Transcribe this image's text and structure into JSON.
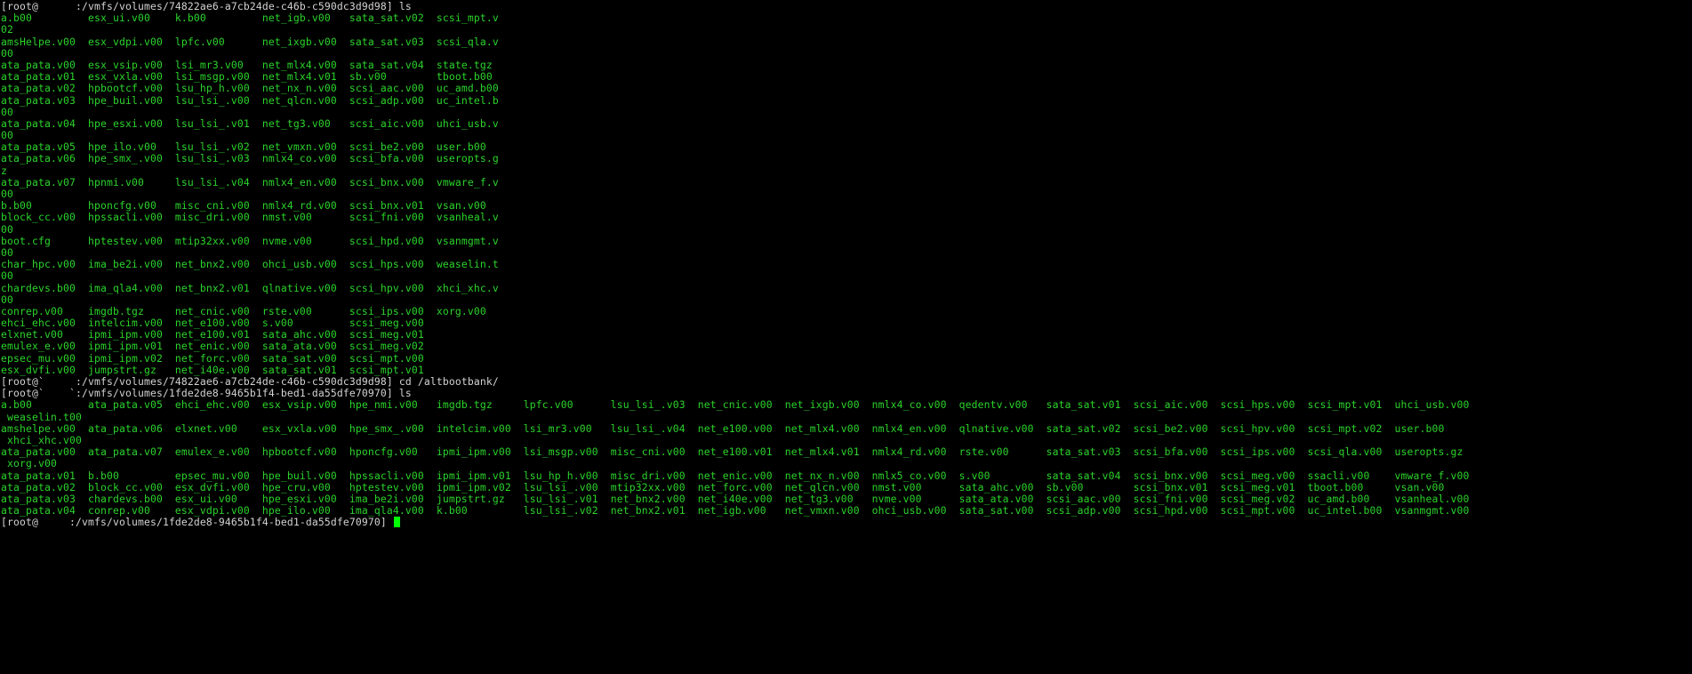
{
  "terminal": {
    "lines": [
      {
        "kind": "prompt",
        "text": "[root@      :/vmfs/volumes/74822ae6-a7cb24de-c46b-c590dc3d9d98] ls"
      },
      {
        "kind": "ls",
        "text": "a.b00         esx_ui.v00    k.b00         net_igb.v00   sata_sat.v02  scsi_mpt.v"
      },
      {
        "kind": "ls",
        "text": "02"
      },
      {
        "kind": "ls",
        "text": "amsHelpe.v00  esx_vdpi.v00  lpfc.v00      net_ixgb.v00  sata_sat.v03  scsi_qla.v"
      },
      {
        "kind": "ls",
        "text": "00"
      },
      {
        "kind": "ls",
        "text": "ata_pata.v00  esx_vsip.v00  lsi_mr3.v00   net_mlx4.v00  sata_sat.v04  state.tgz"
      },
      {
        "kind": "ls",
        "text": "ata_pata.v01  esx_vxla.v00  lsi_msgp.v00  net_mlx4.v01  sb.v00        tboot.b00"
      },
      {
        "kind": "ls",
        "text": "ata_pata.v02  hpbootcf.v00  lsu_hp_h.v00  net_nx_n.v00  scsi_aac.v00  uc_amd.b00"
      },
      {
        "kind": "ls",
        "text": "ata_pata.v03  hpe_buil.v00  lsu_lsi_.v00  net_qlcn.v00  scsi_adp.v00  uc_intel.b"
      },
      {
        "kind": "ls",
        "text": "00"
      },
      {
        "kind": "ls",
        "text": "ata_pata.v04  hpe_esxi.v00  lsu_lsi_.v01  net_tg3.v00   scsi_aic.v00  uhci_usb.v"
      },
      {
        "kind": "ls",
        "text": "00"
      },
      {
        "kind": "ls",
        "text": "ata_pata.v05  hpe_ilo.v00   lsu_lsi_.v02  net_vmxn.v00  scsi_be2.v00  user.b00"
      },
      {
        "kind": "ls",
        "text": "ata_pata.v06  hpe_smx_.v00  lsu_lsi_.v03  nmlx4_co.v00  scsi_bfa.v00  useropts.g"
      },
      {
        "kind": "ls",
        "text": "z"
      },
      {
        "kind": "ls",
        "text": "ata_pata.v07  hpnmi.v00     lsu_lsi_.v04  nmlx4_en.v00  scsi_bnx.v00  vmware_f.v"
      },
      {
        "kind": "ls",
        "text": "00"
      },
      {
        "kind": "ls",
        "text": "b.b00         hponcfg.v00   misc_cni.v00  nmlx4_rd.v00  scsi_bnx.v01  vsan.v00"
      },
      {
        "kind": "ls",
        "text": "block_cc.v00  hpssacli.v00  misc_dri.v00  nmst.v00      scsi_fni.v00  vsanheal.v"
      },
      {
        "kind": "ls",
        "text": "00"
      },
      {
        "kind": "ls",
        "text": "boot.cfg      hptestev.v00  mtip32xx.v00  nvme.v00      scsi_hpd.v00  vsanmgmt.v"
      },
      {
        "kind": "ls",
        "text": "00"
      },
      {
        "kind": "ls",
        "text": "char_hpc.v00  ima_be2i.v00  net_bnx2.v00  ohci_usb.v00  scsi_hps.v00  weaselin.t"
      },
      {
        "kind": "ls",
        "text": "00"
      },
      {
        "kind": "ls",
        "text": "chardevs.b00  ima_qla4.v00  net_bnx2.v01  qlnative.v00  scsi_hpv.v00  xhci_xhc.v"
      },
      {
        "kind": "ls",
        "text": "00"
      },
      {
        "kind": "ls",
        "text": "conrep.v00    imgdb.tgz     net_cnic.v00  rste.v00      scsi_ips.v00  xorg.v00"
      },
      {
        "kind": "ls",
        "text": "ehci_ehc.v00  intelcim.v00  net_e100.v00  s.v00         scsi_meg.v00"
      },
      {
        "kind": "ls",
        "text": "elxnet.v00    ipmi_ipm.v00  net_e100.v01  sata_ahc.v00  scsi_meg.v01"
      },
      {
        "kind": "ls",
        "text": "emulex_e.v00  ipmi_ipm.v01  net_enic.v00  sata_ata.v00  scsi_meg.v02"
      },
      {
        "kind": "ls",
        "text": "epsec_mu.v00  ipmi_ipm.v02  net_forc.v00  sata_sat.v00  scsi_mpt.v00"
      },
      {
        "kind": "ls",
        "text": "esx_dvfi.v00  jumpstrt.gz   net_i40e.v00  sata_sat.v01  scsi_mpt.v01"
      },
      {
        "kind": "prompt",
        "text": "[root@`     :/vmfs/volumes/74822ae6-a7cb24de-c46b-c590dc3d9d98] cd /altbootbank/"
      },
      {
        "kind": "prompt",
        "text": "[root@`    `:/vmfs/volumes/1fde2de8-9465b1f4-bed1-da55dfe70970] ls"
      },
      {
        "kind": "ls",
        "text": "a.b00         ata_pata.v05  ehci_ehc.v00  esx_vsip.v00  hpe_nmi.v00   imgdb.tgz     lpfc.v00      lsu_lsi_.v03  net_cnic.v00  net_ixgb.v00  nmlx4_co.v00  qedentv.v00   sata_sat.v01  scsi_aic.v00  scsi_hps.v00  scsi_mpt.v01  uhci_usb.v00"
      },
      {
        "kind": "ls",
        "text": " weaselin.t00"
      },
      {
        "kind": "ls",
        "text": "amshelpe.v00  ata_pata.v06  elxnet.v00    esx_vxla.v00  hpe_smx_.v00  intelcim.v00  lsi_mr3.v00   lsu_lsi_.v04  net_e100.v00  net_mlx4.v00  nmlx4_en.v00  qlnative.v00  sata_sat.v02  scsi_be2.v00  scsi_hpv.v00  scsi_mpt.v02  user.b00"
      },
      {
        "kind": "ls",
        "text": " xhci_xhc.v00"
      },
      {
        "kind": "ls",
        "text": "ata_pata.v00  ata_pata.v07  emulex_e.v00  hpbootcf.v00  hponcfg.v00   ipmi_ipm.v00  lsi_msgp.v00  misc_cni.v00  net_e100.v01  net_mlx4.v01  nmlx4_rd.v00  rste.v00      sata_sat.v03  scsi_bfa.v00  scsi_ips.v00  scsi_qla.v00  useropts.gz"
      },
      {
        "kind": "ls",
        "text": " xorg.v00"
      },
      {
        "kind": "ls",
        "text": "ata_pata.v01  b.b00         epsec_mu.v00  hpe_buil.v00  hpssacli.v00  ipmi_ipm.v01  lsu_hp_h.v00  misc_dri.v00  net_enic.v00  net_nx_n.v00  nmlx5_co.v00  s.v00         sata_sat.v04  scsi_bnx.v00  scsi_meg.v00  ssacli.v00    vmware_f.v00"
      },
      {
        "kind": "ls",
        "text": "ata_pata.v02  block_cc.v00  esx_dvfi.v00  hpe_cru.v00   hptestev.v00  ipmi_ipm.v02  lsu_lsi_.v00  mtip32xx.v00  net_forc.v00  net_qlcn.v00  nmst.v00      sata_ahc.v00  sb.v00        scsi_bnx.v01  scsi_meg.v01  tboot.b00     vsan.v00"
      },
      {
        "kind": "ls",
        "text": "ata_pata.v03  chardevs.b00  esx_ui.v00    hpe_esxi.v00  ima_be2i.v00  jumpstrt.gz   lsu_lsi_.v01  net_bnx2.v00  net_i40e.v00  net_tg3.v00   nvme.v00      sata_ata.v00  scsi_aac.v00  scsi_fni.v00  scsi_meg.v02  uc_amd.b00    vsanheal.v00"
      },
      {
        "kind": "ls",
        "text": "ata_pata.v04  conrep.v00    esx_vdpi.v00  hpe_ilo.v00   ima_qla4.v00  k.b00         lsu_lsi_.v02  net_bnx2.v01  net_igb.v00   net_vmxn.v00  ohci_usb.v00  sata_sat.v00  scsi_adp.v00  scsi_hpd.v00  scsi_mpt.v00  uc_intel.b00  vsanmgmt.v00"
      },
      {
        "kind": "prompt",
        "text": "[root@     :/vmfs/volumes/1fde2de8-9465b1f4-bed1-da55dfe70970] "
      }
    ],
    "colors": {
      "background": "#000000",
      "prompt_text": "#d3d3d3",
      "listing_text": "#2bd42b",
      "cursor": "#00ff00"
    }
  }
}
